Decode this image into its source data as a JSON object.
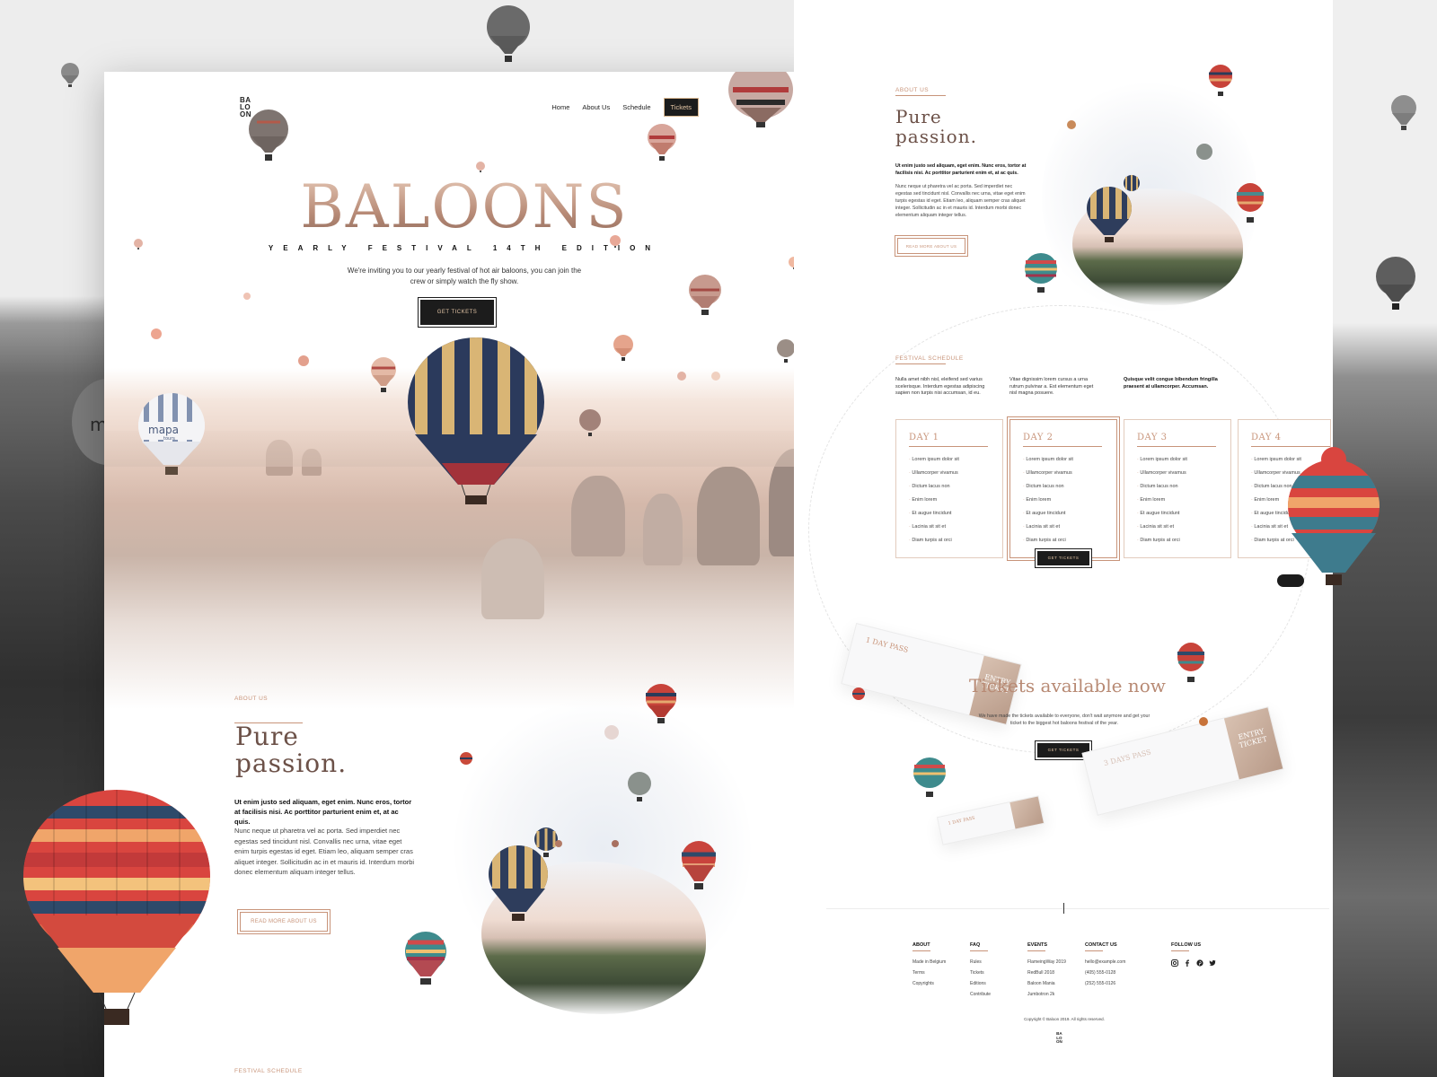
{
  "colors": {
    "accent": "#c8947a",
    "dark": "#1c1c1c",
    "title_gold": "#b88a74"
  },
  "brand": {
    "logo_lines": [
      "BA",
      "LO",
      "ON"
    ]
  },
  "nav": {
    "items": [
      "Home",
      "About Us",
      "Schedule"
    ],
    "tickets": "Tickets"
  },
  "hero": {
    "title": "BALOONS",
    "subtitle": "YEARLY FESTIVAL 14TH EDITION",
    "description": "We're inviting you to our yearly festival of hot air baloons, you can join the crew or simply watch the fly show.",
    "cta": "GET TICKETS",
    "balloon_text": [
      "mapa",
      "tours"
    ]
  },
  "about": {
    "label": "ABOUT US",
    "heading_line1": "Pure",
    "heading_line2": "passion.",
    "bold_text": "Ut enim justo sed aliquam, eget enim. Nunc eros, tortor at facilisis nisi. Ac porttitor parturient enim et, at ac quis.",
    "body_text": " Nunc neque ut pharetra vel ac porta. Sed imperdiet nec egestas sed tincidunt nisl. Convallis nec urna, vitae eget enim turpis egestas id eget. Etiam leo, aliquam semper cras aliquet integer. Sollicitudin ac in et mauris id. Interdum morbi donec elementum aliquam integer tellus.",
    "button": "READ MORE ABOUT US"
  },
  "schedule": {
    "label": "FESTIVAL SCHEDULE",
    "intro": [
      "Nulla amet nibh nisl, eleifend sed varius scelerisque. Interdum egestas adipiscing sapien non turpis nisi accumsan, id eu.",
      "Vitae dignissim lorem cursus a urna rutrum pulvinar a. Est elementum eget nisl magna posuere.",
      "Quisque velit congue bibendum fringilla praesent at ullamcorper. Accumsan."
    ],
    "days": [
      {
        "title": "DAY 1",
        "items": [
          "Lorem ipsum dolor sit",
          "Ullamcorper vivamus",
          "Dictum lacus non",
          "Enim lorem",
          "Et augue tincidunt",
          "Lacinia sit sit et",
          "Diam turpis at orci"
        ]
      },
      {
        "title": "DAY 2",
        "items": [
          "Lorem ipsum dolor sit",
          "Ullamcorper vivamus",
          "Dictum lacus non",
          "Enim lorem",
          "Et augue tincidunt",
          "Lacinia sit sit et",
          "Diam turpis at orci"
        ]
      },
      {
        "title": "DAY 3",
        "items": [
          "Lorem ipsum dolor sit",
          "Ullamcorper vivamus",
          "Dictum lacus non",
          "Enim lorem",
          "Et augue tincidunt",
          "Lacinia sit sit et",
          "Diam turpis at orci"
        ]
      },
      {
        "title": "DAY 4",
        "items": [
          "Lorem ipsum dolor sit",
          "Ullamcorper vivamus",
          "Dictum lacus non",
          "Enim lorem",
          "Et augue tincidunt",
          "Lacinia sit sit et",
          "Diam turpis at orci"
        ]
      }
    ],
    "cta": "GET TICKETS"
  },
  "tickets": {
    "heading": "Tickets available now",
    "description": "We have made the tickets available to everyone, don't wait anymore and get your ticket to the biggest hot baloons festival of the year.",
    "cta": "GET TICKETS",
    "pass_1": "1 DAY PASS",
    "pass_2": "3 DAYS PASS",
    "pass_3": "1 DAY PASS",
    "stub_text": "ENTRY TICKET"
  },
  "footer": {
    "columns": [
      {
        "heading": "ABOUT",
        "items": [
          "Made in Belgium",
          "Terms",
          "Copyrights"
        ]
      },
      {
        "heading": "FAQ",
        "items": [
          "Rules",
          "Tickets",
          "Editions",
          "Contribute"
        ]
      },
      {
        "heading": "EVENTS",
        "items": [
          "FlameingWay 2019",
          "RedBull 2018",
          "Baloon Mania",
          "Jumbotron 2k"
        ]
      },
      {
        "heading": "CONTACT US",
        "items": [
          "hello@example.com",
          "(405) 555-0128",
          "(252) 555-0126"
        ]
      },
      {
        "heading": "FOLLOW US",
        "items": []
      }
    ],
    "social_icons": [
      "instagram-icon",
      "facebook-icon",
      "pinterest-icon",
      "twitter-icon"
    ],
    "copyright": "Copyright © Baloon 2019. All rights reserved."
  }
}
